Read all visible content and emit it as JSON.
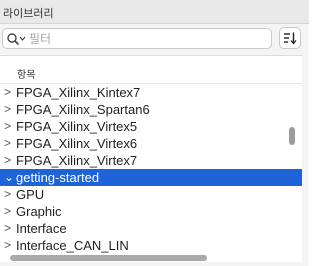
{
  "panel": {
    "title": "라이브러리"
  },
  "search": {
    "placeholder": "필터",
    "value": ""
  },
  "list": {
    "column_header": "항목",
    "rows": [
      {
        "label": "FPGA_Xilinx_Kintex7",
        "expanded": false,
        "selected": false
      },
      {
        "label": "FPGA_Xilinx_Spartan6",
        "expanded": false,
        "selected": false
      },
      {
        "label": "FPGA_Xilinx_Virtex5",
        "expanded": false,
        "selected": false
      },
      {
        "label": "FPGA_Xilinx_Virtex6",
        "expanded": false,
        "selected": false
      },
      {
        "label": "FPGA_Xilinx_Virtex7",
        "expanded": false,
        "selected": false
      },
      {
        "label": "getting-started",
        "expanded": true,
        "selected": true
      },
      {
        "label": "GPU",
        "expanded": false,
        "selected": false
      },
      {
        "label": "Graphic",
        "expanded": false,
        "selected": false
      },
      {
        "label": "Interface",
        "expanded": false,
        "selected": false
      },
      {
        "label": "Interface_CAN_LIN",
        "expanded": false,
        "selected": false
      }
    ],
    "collapsed_glyph": ">",
    "expanded_glyph": "⌄"
  },
  "colors": {
    "selection": "#1f63d8",
    "accent_text": "#ffffff"
  },
  "icons": {
    "search": "search-icon",
    "sort": "sort-icon"
  }
}
